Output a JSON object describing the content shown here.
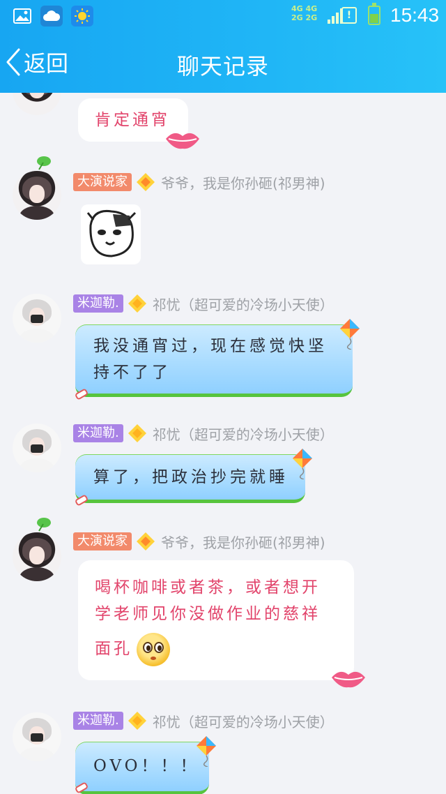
{
  "status_bar": {
    "network_label_1": "4G 4G",
    "network_label_2": "2G 2G",
    "alert_symbol": "!",
    "time": "15:43",
    "icons": [
      "gallery-icon",
      "cloud-icon",
      "sun-icon",
      "signal-icon",
      "alert-icon",
      "battery-icon"
    ]
  },
  "header": {
    "back_label": "返回",
    "title": "聊天记录"
  },
  "colors": {
    "header_gradient_start": "#17a6f2",
    "header_gradient_end": "#27c2f8",
    "background": "#f2f3f7",
    "badge_orange": "#f28a6b",
    "badge_purple": "#a983e6",
    "pink_text": "#e2446b",
    "blue_bubble": "#aadcff",
    "bubble_grass": "#57c43e"
  },
  "messages": [
    {
      "badge": "",
      "nick": "",
      "text": "肯定通宵",
      "bubble": "pink",
      "decoration": "lips"
    },
    {
      "badge": "大演说家",
      "nick": "爷爷，我是你孙砸(祁男神)",
      "type": "sticker",
      "sticker": "cartoon-face"
    },
    {
      "badge": "米迦勒.",
      "nick": "祁忧（超可爱的冷场小天使）",
      "text": "我没通宵过，现在感觉快坚\n持不了了",
      "bubble": "blue"
    },
    {
      "badge": "米迦勒.",
      "nick": "祁忧（超可爱的冷场小天使）",
      "text": "算了，把政治抄完就睡",
      "bubble": "blue"
    },
    {
      "badge": "大演说家",
      "nick": "爷爷，我是你孙砸(祁男神)",
      "text_line1": "喝杯咖啡或者茶，或者想开",
      "text_line2": "学老师见你没做作业的慈祥",
      "text_line3": "面孔",
      "bubble": "pink",
      "emoji": "pleading-face",
      "decoration": "lips"
    },
    {
      "badge": "米迦勒.",
      "nick": "祁忧（超可爱的冷场小天使）",
      "text": "OVO！！！",
      "bubble": "blue"
    }
  ]
}
